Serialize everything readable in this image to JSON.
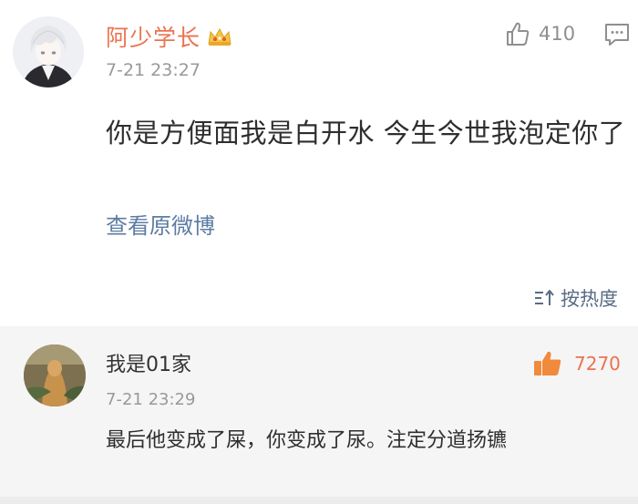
{
  "post": {
    "author": "阿少学长",
    "time": "7-21 23:27",
    "like_count": "410",
    "text": "你是方便面我是白开水  今生今世我泡定你了",
    "view_original": "查看原微博",
    "sort_label": "按热度",
    "icons": {
      "avatar": "anime-avatar",
      "badge": "crown-icon",
      "like": "thumbs-up-outline-icon",
      "comment": "comment-bubble-icon",
      "sort": "sort-arrows-icon"
    }
  },
  "comment": {
    "author": "我是01家",
    "time": "7-21 23:29",
    "like_count": "7270",
    "text": "最后他变成了屎，你变成了尿。注定分道扬镳",
    "icons": {
      "avatar": "photo-avatar",
      "like": "thumbs-up-filled-icon"
    }
  },
  "colors": {
    "author_orange": "#eb7350",
    "link_blue": "#5d7ca3",
    "muted_gray": "#999999",
    "comment_bg": "#f5f5f5"
  }
}
